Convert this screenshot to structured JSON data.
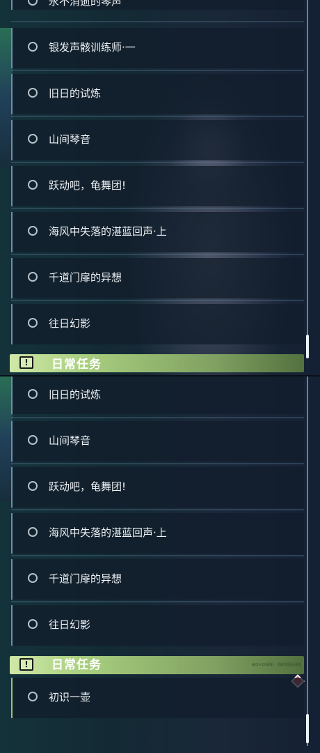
{
  "top_panel": {
    "partial_top_item": "永不消逝的琴声",
    "items": [
      {
        "label": "银发声骸训练师·一"
      },
      {
        "label": "旧日的试炼"
      },
      {
        "label": "山间琴音"
      },
      {
        "label": "跃动吧，龟舞团!"
      },
      {
        "label": "海风中失落的湛蓝回声·上"
      },
      {
        "label": "千道门扉的异想"
      },
      {
        "label": "往日幻影"
      }
    ],
    "partial_section_title": "日常任务"
  },
  "bottom_panel": {
    "items": [
      {
        "label": "旧日的试炼"
      },
      {
        "label": "山间琴音"
      },
      {
        "label": "跃动吧，龟舞团!"
      },
      {
        "label": "海风中失落的湛蓝回声·上"
      },
      {
        "label": "千道门扉的异想"
      },
      {
        "label": "往日幻影"
      }
    ],
    "daily_section": {
      "icon": "exclamation-icon",
      "title": "日常任务",
      "hint": "每日4:00刷新，领取奖励后消失"
    },
    "daily_items": [
      {
        "label": "初识一壶"
      }
    ]
  },
  "colors": {
    "daily_header_accent": "#a9cf7f",
    "notification_diamond": "#e04050",
    "quest_border": "#6f8fa6"
  }
}
